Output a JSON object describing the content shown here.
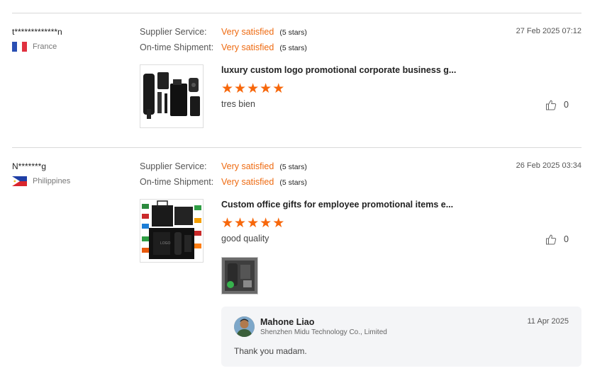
{
  "reviews": [
    {
      "user": "t*************n",
      "country": "France",
      "ratings": [
        {
          "label": "Supplier Service:",
          "value": "Very satisfied",
          "stars": "(5 stars)"
        },
        {
          "label": "On-time Shipment:",
          "value": "Very satisfied",
          "stars": "(5 stars)"
        }
      ],
      "date": "27 Feb 2025 07:12",
      "product_title": "luxury custom logo promotional corporate business g...",
      "star_count": 5,
      "comment": "tres bien",
      "likes": "0"
    },
    {
      "user": "N*******g",
      "country": "Philippines",
      "ratings": [
        {
          "label": "Supplier Service:",
          "value": "Very satisfied",
          "stars": "(5 stars)"
        },
        {
          "label": "On-time Shipment:",
          "value": "Very satisfied",
          "stars": "(5 stars)"
        }
      ],
      "date": "26 Feb 2025 03:34",
      "product_title": "Custom office gifts for employee promotional items e...",
      "star_count": 5,
      "comment": "good quality",
      "likes": "0",
      "reply": {
        "name": "Mahone Liao",
        "company": "Shenzhen Midu Technology Co., Limited",
        "date": "11 Apr 2025",
        "text": "Thank you madam."
      }
    }
  ],
  "colors": {
    "accent": "#ee6a10",
    "star": "#f7670b",
    "divider": "#d9d9d9"
  },
  "icons": {
    "like": "thumbs-up-icon",
    "star": "star-icon"
  }
}
